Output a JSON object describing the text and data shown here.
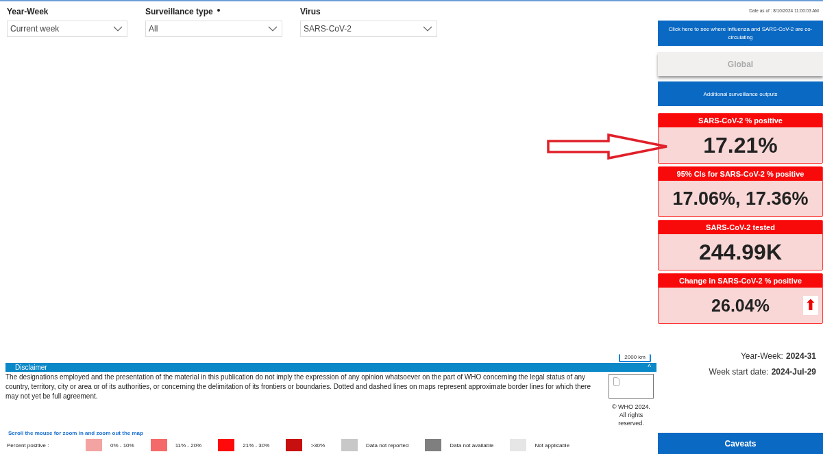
{
  "filters": [
    {
      "label": "Year-Week",
      "required": false,
      "value": "Current week"
    },
    {
      "label": "Surveillance type",
      "required": true,
      "value": "All"
    },
    {
      "label": "Virus",
      "required": false,
      "value": "SARS-CoV-2"
    }
  ],
  "scale_bar": "2000 km",
  "disclaimer": {
    "title": "Disclaimer",
    "toggle": "^",
    "text": "The designations employed and the presentation of the material in this publication do not imply the expression of any opinion whatsoever on the part of WHO concerning the legal status of any country, territory, city or area or of its authorities, or concerning the delimitation of its frontiers or boundaries. Dotted and dashed lines on maps represent approximate border lines for which there may not yet be full agreement.",
    "copyright": "© WHO 2024. All rights reserved."
  },
  "map_hint": "Scroll the mouse for zoom in and zoom out the map",
  "legend": {
    "label": "Percent positive :",
    "items": [
      {
        "label": "0% - 10%",
        "color": "#f4a3a3"
      },
      {
        "label": "11% - 20%",
        "color": "#f46a6a"
      },
      {
        "label": "21% - 30%",
        "color": "#ff0a0a"
      },
      {
        "label": ">30%",
        "color": "#c80f0f"
      },
      {
        "label": "Data not reported",
        "color": "#c8c8c8"
      },
      {
        "label": "Data not available",
        "color": "#7f7f7f"
      },
      {
        "label": "Not applicable",
        "color": "#e6e6e6"
      }
    ]
  },
  "side": {
    "date": "Date as of : 8/10/2024 11:00:03 AM",
    "cocirculation_button": "Click here to see where Influenza and SARS-CoV-2 are co-circulating",
    "region_button": "Global",
    "outputs_button": "Additional surveillance outputs",
    "cards": [
      {
        "title": "SARS-CoV-2 % positive",
        "value": "17.21%"
      },
      {
        "title": "95% CIs for SARS-CoV-2 % positive",
        "value": "17.06%, 17.36%"
      },
      {
        "title": "SARS-CoV-2 tested",
        "value": "244.99K"
      },
      {
        "title": "Change in SARS-CoV-2 % positive",
        "value": "26.04%",
        "trend": "⬆"
      }
    ],
    "year_week": {
      "label": "Year-Week:",
      "value": "2024-31"
    },
    "week_start": {
      "label": "Week start date:",
      "value": "2024-Jul-29"
    },
    "caveats_button": "Caveats"
  }
}
